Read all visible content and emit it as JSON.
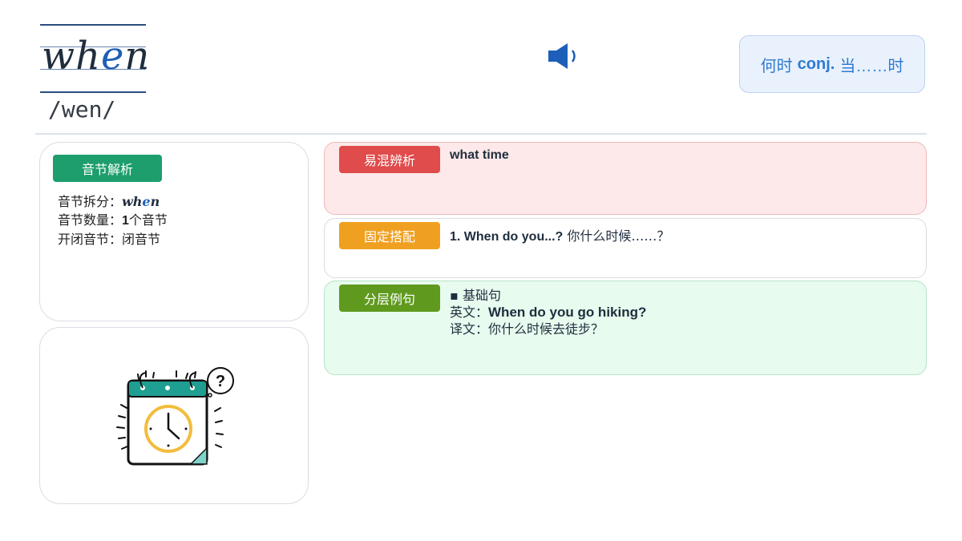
{
  "header": {
    "word": "when",
    "word_parts": [
      "wh",
      "e",
      "n"
    ],
    "phonetic": "/wen/",
    "meaning": {
      "pre": "何时",
      "pos": "conj.",
      "post": "当……时"
    }
  },
  "icons": {
    "speaker": "speaker-icon",
    "illustration": "calendar-clock-question-icon"
  },
  "syllable_card": {
    "tag": "音节解析",
    "split_label": "音节拆分：",
    "split_parts": [
      "wh",
      "e",
      "n"
    ],
    "count_label": "音节数量：",
    "count_value": "1",
    "count_unit": "个音节",
    "type_label": "开闭音节：",
    "type_value": "闭音节"
  },
  "confusable": {
    "tag": "易混辨析",
    "text": "what time"
  },
  "collocation": {
    "tag": "固定搭配",
    "en": "1. When do you...?",
    "zh": " 你什么时候……？"
  },
  "examples": {
    "tag": "分层例句",
    "level": "基础句",
    "en_label": "英文：",
    "en": "When do you go hiking?",
    "zh_label": "译文：",
    "zh": "你什么时候去徒步？"
  },
  "colors": {
    "syllable_tag": "#1e9e6c",
    "confusable_tag": "#e04b4b",
    "collocation_tag": "#f0a020",
    "examples_tag": "#5f9a1e",
    "accent_blue": "#1d5fb8"
  }
}
